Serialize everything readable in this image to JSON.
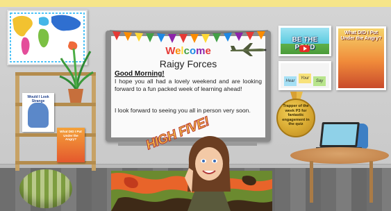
{
  "whiteboard": {
    "welcome_letters": [
      {
        "ch": "W",
        "color": "#e53935"
      },
      {
        "ch": "e",
        "color": "#fb8c00"
      },
      {
        "ch": "l",
        "color": "#fdd835"
      },
      {
        "ch": "c",
        "color": "#43a047"
      },
      {
        "ch": "o",
        "color": "#1e88e5"
      },
      {
        "ch": "m",
        "color": "#8e24aa"
      },
      {
        "ch": "e",
        "color": "#e53935"
      }
    ],
    "class_name": "Raigy Forces",
    "greeting": "Good Morning!",
    "message_1": "I hope you all had a lovely weekend and are looking forward to a fun packed week of learning ahead!",
    "message_2": "I look forward to seeing you all in person very soon."
  },
  "links": {
    "pond_video_title": "BE THE POND",
    "sticky_notes": [
      "Hear",
      "Your",
      "Say"
    ],
    "book_card_title": "What DID I Put Under the Angry?"
  },
  "medal": {
    "text": "Trapper of the week P3 for fantastic engagement in the quiz"
  },
  "shelf_books": {
    "book1_title": "Would I Look Strange",
    "book2_title": "What DID I Put Under the Angry?"
  },
  "sticker": {
    "text": "HIGH FIVE!"
  },
  "colors": {
    "topbar": "#f6e58a",
    "wall": "#d4d4d4",
    "accent_red": "#e53935"
  },
  "icons": [
    "world-map-icon",
    "plant-icon",
    "airplane-icon",
    "medal-icon",
    "laptop-icon",
    "play-icon"
  ]
}
